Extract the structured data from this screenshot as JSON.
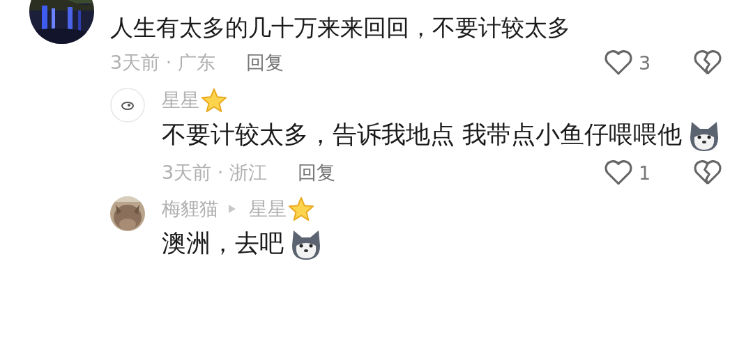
{
  "comments": [
    {
      "text": "人生有太多的几十万来来回回，不要计较太多",
      "meta": "3天前 · 广东",
      "reply_label": "回复",
      "likes": "3",
      "replies": [
        {
          "avatar": {
            "kind": "icon"
          },
          "names": [
            {
              "name": "星星",
              "star_badge": true
            }
          ],
          "text": "不要计较太多，告诉我地点  我带点小鱼仔喂喂他",
          "sticker": true,
          "meta": "3天前 · 浙江",
          "reply_label": "回复",
          "likes": "1"
        },
        {
          "names": [
            {
              "name": "梅貍猫",
              "star_badge": false
            },
            {
              "name": "星星",
              "star_badge": true
            }
          ],
          "text": "澳洲，去吧",
          "sticker": true
        }
      ]
    }
  ]
}
